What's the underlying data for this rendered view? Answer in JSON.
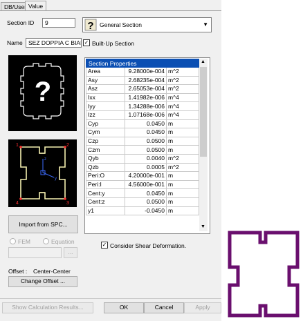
{
  "tabs": [
    "DB/User",
    "Value"
  ],
  "form": {
    "section_id_label": "Section ID",
    "section_id_value": "9",
    "name_label": "Name",
    "name_value": "SEZ DOPPIA C BIAN",
    "section_type": "General Section",
    "built_up_label": "Built-Up Section",
    "built_up_checked": true,
    "import_label": "Import from SPC...",
    "fem_label": "FEM",
    "equation_label": "Equation",
    "browse_label": "...",
    "offset_label": "Offset :",
    "offset_value": "Center-Center",
    "change_offset_label": "Change Offset ...",
    "shear_label": "Consider Shear Deformation.",
    "shear_checked": true
  },
  "properties": {
    "header": "Section Properties",
    "rows": [
      {
        "name": "Area",
        "value": "9.28000e-004",
        "unit": "m^2"
      },
      {
        "name": "Asy",
        "value": "2.68235e-004",
        "unit": "m^2"
      },
      {
        "name": "Asz",
        "value": "2.65053e-004",
        "unit": "m^2"
      },
      {
        "name": "Ixx",
        "value": "1.41982e-006",
        "unit": "m^4"
      },
      {
        "name": "Iyy",
        "value": "1.34288e-006",
        "unit": "m^4"
      },
      {
        "name": "Izz",
        "value": "1.07168e-006",
        "unit": "m^4"
      },
      {
        "name": "Cyp",
        "value": "0.0450",
        "unit": "m"
      },
      {
        "name": "Cym",
        "value": "0.0450",
        "unit": "m"
      },
      {
        "name": "Czp",
        "value": "0.0500",
        "unit": "m"
      },
      {
        "name": "Czm",
        "value": "0.0500",
        "unit": "m"
      },
      {
        "name": "Qyb",
        "value": "0.0040",
        "unit": "m^2"
      },
      {
        "name": "Qzb",
        "value": "0.0005",
        "unit": "m^2"
      },
      {
        "name": "Peri:O",
        "value": "4.20000e-001",
        "unit": "m"
      },
      {
        "name": "Peri:I",
        "value": "4.56000e-001",
        "unit": "m"
      },
      {
        "name": "Cent:y",
        "value": "0.0450",
        "unit": "m"
      },
      {
        "name": "Cent:z",
        "value": "0.0500",
        "unit": "m"
      },
      {
        "name": "y1",
        "value": "-0.0450",
        "unit": "m"
      }
    ]
  },
  "preview": {
    "corner_labels": [
      "1",
      "2",
      "3",
      "4"
    ],
    "axis_y": "y",
    "axis_z": "z"
  },
  "footer": {
    "show_results": "Show Calculation Results...",
    "ok": "OK",
    "cancel": "Cancel",
    "apply": "Apply"
  },
  "colors": {
    "section_outline": "#6a0f6e",
    "preview_outline": "#f5f0b0",
    "header_blue": "#0b4fb3"
  }
}
